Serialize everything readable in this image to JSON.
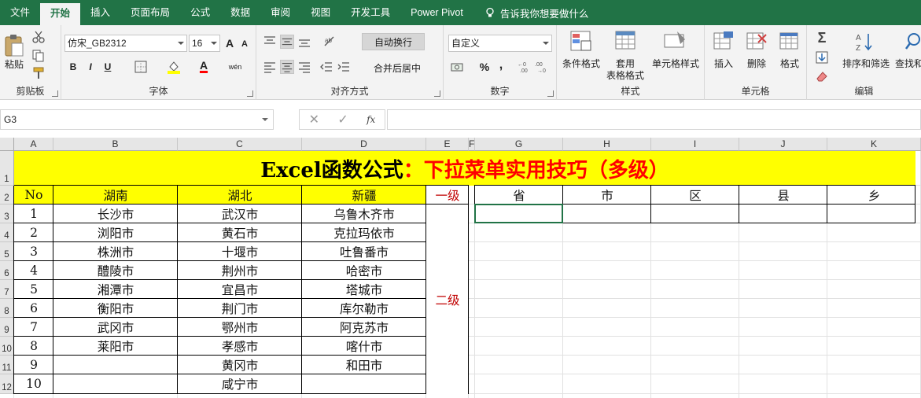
{
  "tabs": [
    "文件",
    "开始",
    "插入",
    "页面布局",
    "公式",
    "数据",
    "审阅",
    "视图",
    "开发工具",
    "Power Pivot"
  ],
  "tell_me": "告诉我你想要做什么",
  "ribbon": {
    "clipboard": {
      "label": "剪贴板",
      "paste": "粘贴"
    },
    "font": {
      "label": "字体",
      "name": "仿宋_GB2312",
      "size": "16",
      "bold": "B",
      "italic": "I",
      "underline": "U",
      "grow": "A",
      "shrink": "A",
      "color_a": "A",
      "wen": "wén"
    },
    "align": {
      "label": "对齐方式",
      "wrap": "自动换行",
      "merge": "合并后居中"
    },
    "number": {
      "label": "数字",
      "format": "自定义",
      "percent": "%",
      "comma": ","
    },
    "styles": {
      "label": "样式",
      "cond": "条件格式",
      "table1": "套用",
      "table2": "表格格式",
      "cell": "单元格样式"
    },
    "cells": {
      "label": "单元格",
      "insert": "插入",
      "delete": "删除",
      "format": "格式"
    },
    "editing": {
      "label": "编辑",
      "sort": "排序和筛选",
      "find": "查找和"
    }
  },
  "namebox": "G3",
  "fx": "fx",
  "columns": [
    "A",
    "B",
    "C",
    "D",
    "E",
    "F",
    "G",
    "H",
    "I",
    "J",
    "K"
  ],
  "rows": [
    "1",
    "2",
    "3",
    "4",
    "5",
    "6",
    "7",
    "8",
    "9",
    "10",
    "11",
    "12"
  ],
  "sheet": {
    "title_black": "Excel函数公式",
    "title_red": "：下拉菜单实用技巧（多级）",
    "headers": [
      "No",
      "湖南",
      "湖北",
      "新疆"
    ],
    "level1": "一级",
    "level2": "二级",
    "data": [
      [
        "1",
        "长沙市",
        "武汉市",
        "乌鲁木齐市"
      ],
      [
        "2",
        "浏阳市",
        "黄石市",
        "克拉玛依市"
      ],
      [
        "3",
        "株洲市",
        "十堰市",
        "吐鲁番市"
      ],
      [
        "4",
        "醴陵市",
        "荆州市",
        "哈密市"
      ],
      [
        "5",
        "湘潭市",
        "宜昌市",
        "塔城市"
      ],
      [
        "6",
        "衡阳市",
        "荆门市",
        "库尔勒市"
      ],
      [
        "7",
        "武冈市",
        "鄂州市",
        "阿克苏市"
      ],
      [
        "8",
        "莱阳市",
        "孝感市",
        "喀什市"
      ],
      [
        "9",
        "",
        "黄冈市",
        "和田市"
      ],
      [
        "10",
        "",
        "咸宁市",
        ""
      ]
    ],
    "right_headers": [
      "省",
      "市",
      "区",
      "县",
      "乡"
    ]
  },
  "colors": {
    "excel_green": "#217346",
    "title_fill": "#ffff00",
    "title_red": "#ff0000",
    "level_red": "#c00000"
  }
}
